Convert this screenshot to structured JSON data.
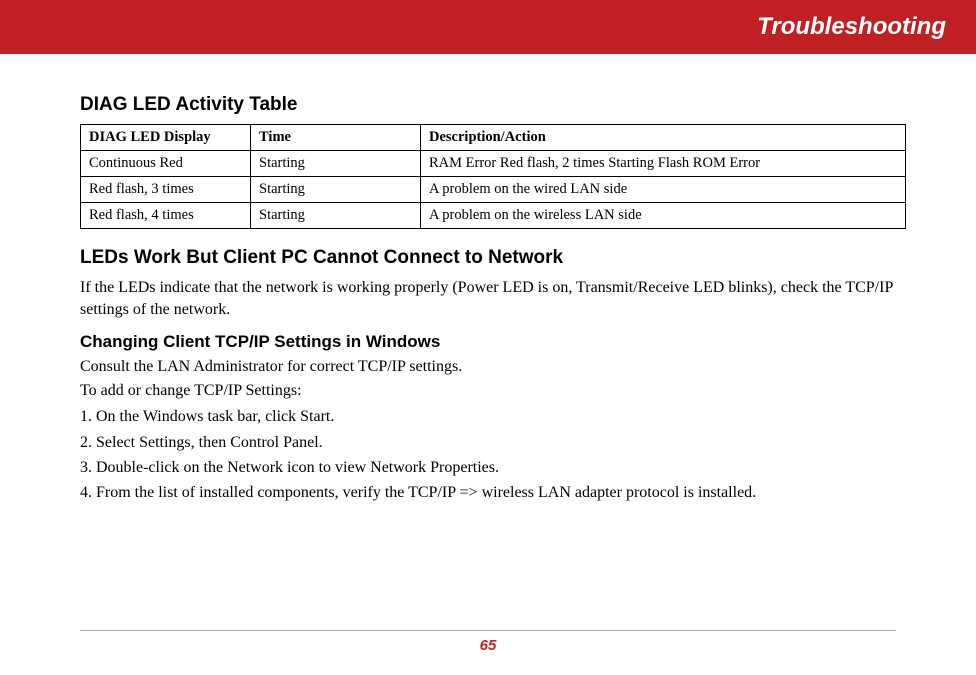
{
  "header": {
    "title": "Troubleshooting"
  },
  "section1": {
    "heading": "DIAG LED Activity Table"
  },
  "table": {
    "headers": {
      "c1": "DIAG LED Display",
      "c2": "Time",
      "c3": "Description/Action"
    },
    "rows": [
      {
        "c1": "Continuous Red",
        "c2": "Starting",
        "c3": "RAM Error Red flash, 2 times Starting Flash ROM Error"
      },
      {
        "c1": "Red flash, 3 times",
        "c2": "Starting",
        "c3": "A problem on the wired LAN side"
      },
      {
        "c1": "Red flash, 4 times",
        "c2": "Starting",
        "c3": "A problem on the wireless LAN side"
      }
    ]
  },
  "section2": {
    "heading": "LEDs Work But Client PC Cannot Connect to Network",
    "body": "If the LEDs indicate that the network is working properly (Power LED is on, Transmit/Receive LED blinks), check the TCP/IP settings of the network."
  },
  "section3": {
    "heading": "Changing Client TCP/IP Settings in Windows",
    "body1": "Consult the LAN Administrator for correct TCP/IP settings.",
    "body2": "To add or change TCP/IP Settings:",
    "steps": {
      "s1": "1. On the Windows task bar, click Start.",
      "s2": "2. Select Settings, then Control Panel.",
      "s3": "3. Double-click on the Network icon to view Network Properties.",
      "s4": "4. From the list of installed components, verify the TCP/IP => wireless LAN adapter protocol is installed."
    }
  },
  "footer": {
    "page": "65"
  }
}
